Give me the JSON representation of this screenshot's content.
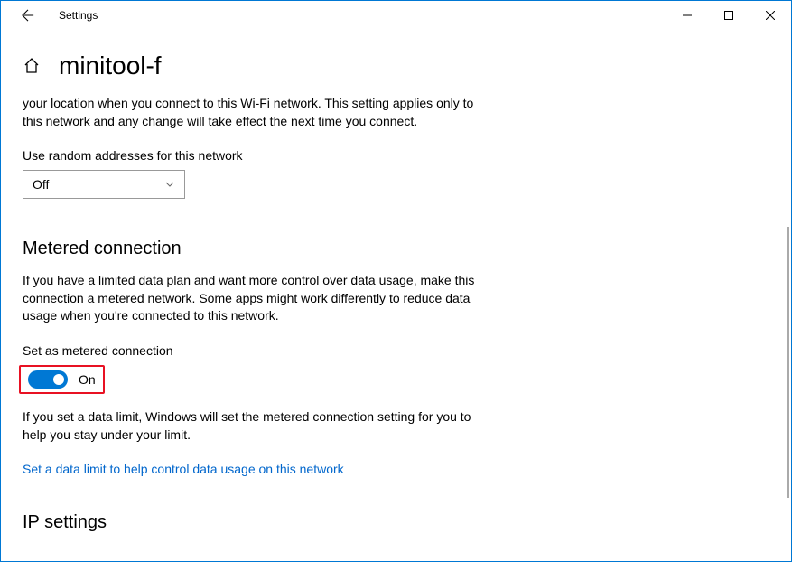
{
  "titlebar": {
    "app_title": "Settings"
  },
  "header": {
    "page_title": "minitool-f"
  },
  "random_mac": {
    "description": "your location when you connect to this Wi-Fi network. This setting applies only to this network and any change will take effect the next time you connect.",
    "label": "Use random addresses for this network",
    "dropdown_value": "Off"
  },
  "metered": {
    "heading": "Metered connection",
    "description": "If you have a limited data plan and want more control over data usage, make this connection a metered network. Some apps might work differently to reduce data usage when you're connected to this network.",
    "toggle_label": "Set as metered connection",
    "toggle_state": "On",
    "limit_desc": "If you set a data limit, Windows will set the metered connection setting for you to help you stay under your limit.",
    "link_text": "Set a data limit to help control data usage on this network"
  },
  "ip": {
    "heading": "IP settings"
  }
}
